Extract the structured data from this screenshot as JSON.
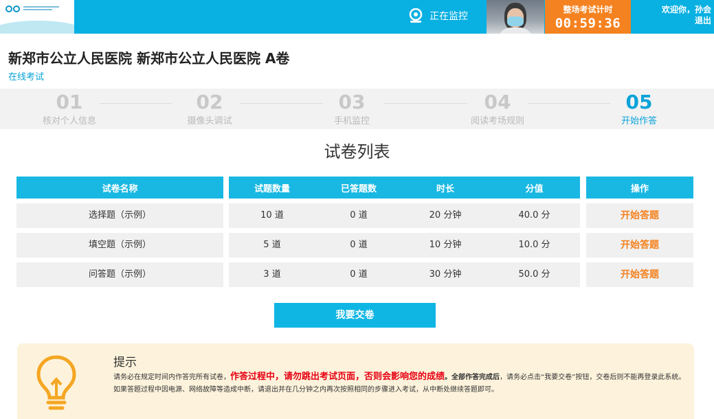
{
  "header": {
    "monitor_label": "正在监控",
    "timer_label": "整场考试计时",
    "timer_value": "00:59:36",
    "welcome": "欢迎你，孙会",
    "logout": "退出"
  },
  "exam": {
    "title": "新郑市公立人民医院 新郑市公立人民医院 A卷",
    "subtitle": "在线考试"
  },
  "steps": [
    {
      "num": "01",
      "label": "核对个人信息"
    },
    {
      "num": "02",
      "label": "摄像头调试"
    },
    {
      "num": "03",
      "label": "手机监控"
    },
    {
      "num": "04",
      "label": "阅读考场规则"
    },
    {
      "num": "05",
      "label": "开始作答"
    }
  ],
  "paper_list": {
    "title": "试卷列表",
    "columns": [
      "试卷名称",
      "试题数量",
      "已答题数",
      "时长",
      "分值",
      "操作"
    ],
    "rows": [
      {
        "name": "选择题（示例）",
        "count": "10 道",
        "answered": "0 道",
        "duration": "20 分钟",
        "score": "40.0 分",
        "action": "开始答题"
      },
      {
        "name": "填空题（示例）",
        "count": "5 道",
        "answered": "0 道",
        "duration": "10 分钟",
        "score": "10.0 分",
        "action": "开始答题"
      },
      {
        "name": "问答题（示例）",
        "count": "3 道",
        "answered": "0 道",
        "duration": "30 分钟",
        "score": "50.0 分",
        "action": "开始答题"
      }
    ],
    "submit_label": "我要交卷"
  },
  "tips": {
    "title": "提示",
    "text_1": "请务必在规定时间内作答完所有试卷，",
    "text_red": "作答过程中，请勿跳出考试页面，否则会影响您的成绩",
    "text_bold": "。全部作答完成后",
    "text_2": "，请务必点击“我要交卷”按钮，交卷后则不能再登录此系统。如果答题过程中因电源、网络故障等造成中断，请退出并在几分钟之内再次按照相同的步骤进入考试，从中断处继续答题即可。"
  },
  "colors": {
    "primary": "#09b0e2",
    "accent": "#f58220",
    "tip_bg": "#fdf3dc"
  }
}
